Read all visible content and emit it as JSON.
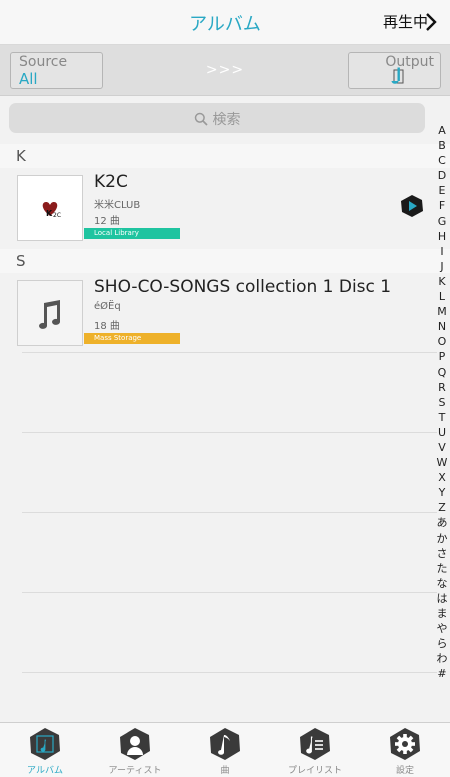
{
  "header": {
    "title": "アルバム",
    "now_playing": "再生中"
  },
  "source_bar": {
    "source_label": "Source",
    "source_value": "All",
    "arrows": ">>>",
    "output_label": "Output"
  },
  "search": {
    "placeholder": "検索"
  },
  "sections": [
    {
      "letter": "K",
      "album": {
        "title": "K2C",
        "artist": "米米CLUB",
        "count": "12 曲",
        "storage": "Local Library",
        "storage_color": "#1fc4a0"
      }
    },
    {
      "letter": "S",
      "album": {
        "title": "SHO-CO-SONGS collection 1 Disc 1",
        "artist": "éØËq",
        "count": "18 曲",
        "storage": "Mass Storage",
        "storage_color": "#eeb12a"
      }
    }
  ],
  "index_letters": [
    "A",
    "B",
    "C",
    "D",
    "E",
    "F",
    "G",
    "H",
    "I",
    "J",
    "K",
    "L",
    "M",
    "N",
    "O",
    "P",
    "Q",
    "R",
    "S",
    "T",
    "U",
    "V",
    "W",
    "X",
    "Y",
    "Z",
    "あ",
    "か",
    "さ",
    "た",
    "な",
    "は",
    "ま",
    "や",
    "ら",
    "わ",
    "#"
  ],
  "tabs": [
    {
      "label": "アルバム",
      "icon": "album-icon"
    },
    {
      "label": "アーティスト",
      "icon": "artist-icon"
    },
    {
      "label": "曲",
      "icon": "song-icon"
    },
    {
      "label": "プレイリスト",
      "icon": "playlist-icon"
    },
    {
      "label": "設定",
      "icon": "settings-icon"
    }
  ],
  "colors": {
    "accent": "#29a8c4",
    "tab_icon": "#3a3a3a"
  }
}
